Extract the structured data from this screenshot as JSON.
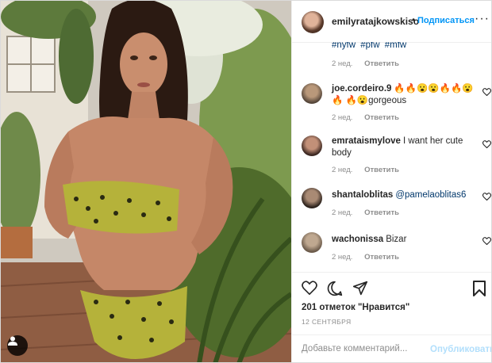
{
  "post": {
    "username": "emilyratajkowskiso",
    "dot": "•",
    "follow_label": "Подписаться",
    "more_label": "···"
  },
  "caption": {
    "hashtags": [
      "#nyfw",
      "#pfw",
      "#mfw"
    ],
    "time": "2 нед.",
    "reply": "Ответить"
  },
  "comments": [
    {
      "username": "joe.cordeiro.9",
      "text": "🔥🔥😮😮🔥🔥😮🔥 🔥😮gorgeous",
      "time": "2 нед.",
      "reply": "Ответить"
    },
    {
      "username": "emrataismylove",
      "text": "I want her cute body",
      "time": "2 нед.",
      "reply": "Ответить"
    },
    {
      "username": "shantaloblitas",
      "mention": "@pamelaoblitas6",
      "time": "2 нед.",
      "reply": "Ответить"
    },
    {
      "username": "wachonissa",
      "text": "Bizar",
      "time": "2 нед.",
      "reply": "Ответить"
    }
  ],
  "actions": {
    "likes": "201 отметок \"Нравится\"",
    "date": "12 СЕНТЯБРЯ",
    "comment_placeholder": "Добавьте комментарий...",
    "publish_label": "Опубликовать"
  },
  "icons": {
    "like": "heart-icon",
    "comment": "comment-icon",
    "share": "share-icon",
    "save": "bookmark-icon",
    "tag": "person-tag-icon",
    "comment_like": "heart-outline-icon"
  },
  "colors": {
    "accent": "#0095f6",
    "link": "#00376b",
    "muted": "#8e8e8e",
    "publish_disabled": "#b2dffc"
  }
}
